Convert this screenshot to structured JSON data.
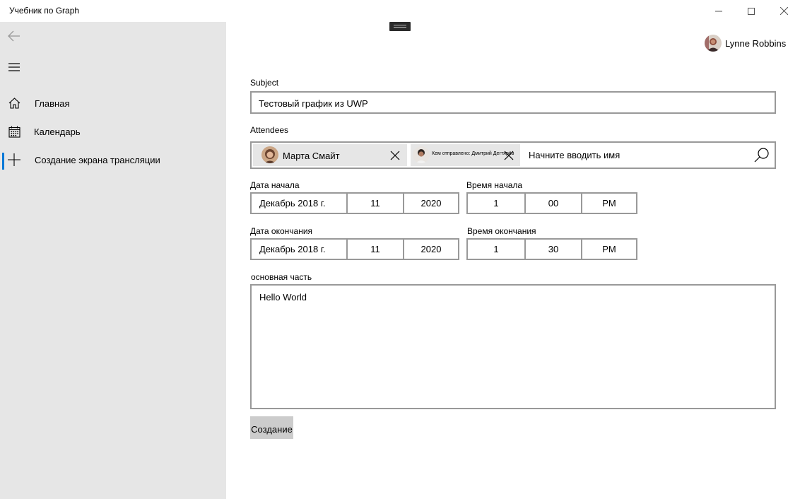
{
  "window": {
    "title": "Учебник по Graph"
  },
  "sidebar": {
    "items": [
      {
        "label": "Главная",
        "icon": "home-icon"
      },
      {
        "label": "Календарь",
        "icon": "calendar-icon"
      },
      {
        "label": "Создание экрана трансляции",
        "icon": "plus-icon",
        "selected": true
      }
    ]
  },
  "user": {
    "name": "Lynne Robbins"
  },
  "form": {
    "subject_label": "Subject",
    "subject_value": "Тестовый график из UWP",
    "attendees_label": "Attendees",
    "attendees": [
      {
        "name": "Марта Смайт"
      },
      {
        "name": "Кем отправлено: Дмитрий Дегтярёв"
      }
    ],
    "attendees_placeholder": "Начните вводить имя",
    "start_date_label": "Дата начала",
    "start_date": {
      "month": "Декабрь 2018 г.",
      "day": "11",
      "year": "2020"
    },
    "start_time_label": "Время начала",
    "start_time": {
      "hour": "1",
      "minute": "00",
      "period": "PM"
    },
    "end_date_label": "Дата окончания",
    "end_date": {
      "month": "Декабрь 2018 г.",
      "day": "11",
      "year": "2020"
    },
    "end_time_label": "Время окончания",
    "end_time": {
      "hour": "1",
      "minute": "30",
      "period": "PM"
    },
    "body_label": "основная часть",
    "body_value": "Hello World",
    "create_label": "Создание"
  },
  "colors": {
    "sidebar_bg": "#e6e6e6",
    "accent": "#0078d7",
    "border": "#999999",
    "chip_bg": "#e6e6e6",
    "button_bg": "#cccccc"
  }
}
